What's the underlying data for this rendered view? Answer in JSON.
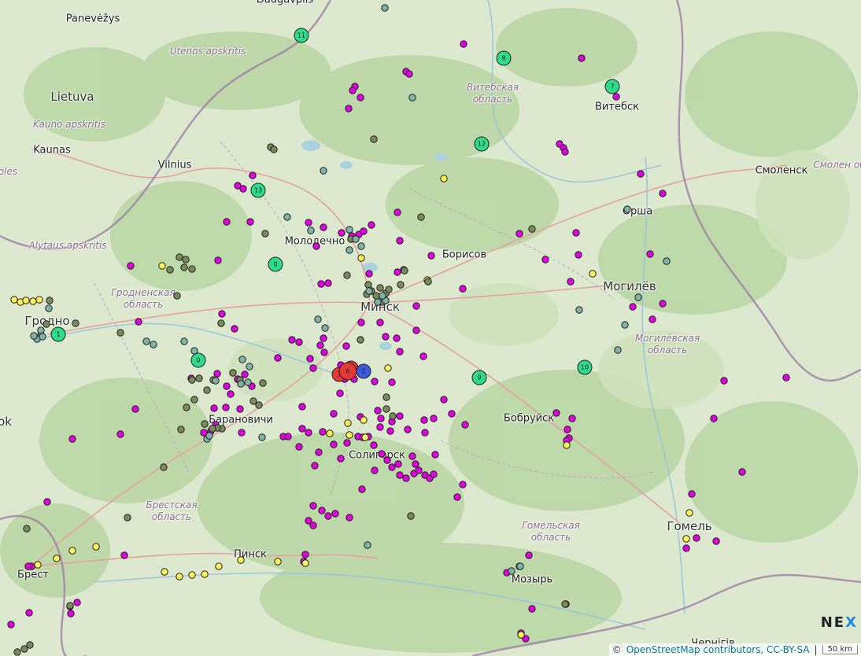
{
  "map": {
    "region_labels": [
      {
        "id": "utenos",
        "text": "Utenos apskritis"
      },
      {
        "id": "kauno",
        "text": "Kauno apskritis"
      },
      {
        "id": "alytaus",
        "text": "Alytaus apskritis"
      },
      {
        "id": "vitebsk-obl",
        "text": "Витебская область"
      },
      {
        "id": "grodno-obl",
        "text": "Гродненская область"
      },
      {
        "id": "mogilev-obl",
        "text": "Могилёвская область"
      },
      {
        "id": "brest-obl",
        "text": "Брестская область"
      },
      {
        "id": "gomel-obl",
        "text": "Гомельская область"
      },
      {
        "id": "smolensk-obl",
        "text": "Смолен обла"
      },
      {
        "id": "poles-obl",
        "text": "olės"
      }
    ],
    "city_labels": [
      {
        "id": "panevezys",
        "text": "Panevėžys"
      },
      {
        "id": "daugavpils",
        "text": "Daugavpils"
      },
      {
        "id": "lietuva",
        "text": "Lietuva"
      },
      {
        "id": "kaunas",
        "text": "Kaunas"
      },
      {
        "id": "vilnius",
        "text": "Vilnius"
      },
      {
        "id": "vitebsk",
        "text": "Витебск"
      },
      {
        "id": "smolensk",
        "text": "Смоленск"
      },
      {
        "id": "orsha",
        "text": "Орша"
      },
      {
        "id": "molodechno",
        "text": "Молодечно"
      },
      {
        "id": "borisov",
        "text": "Борисов"
      },
      {
        "id": "minsk",
        "text": "Минск"
      },
      {
        "id": "mogilev",
        "text": "Могилёв"
      },
      {
        "id": "grodno",
        "text": "Гродно"
      },
      {
        "id": "baranovichi",
        "text": "Барановичи"
      },
      {
        "id": "bobruisk",
        "text": "Бобруйск"
      },
      {
        "id": "soligorsk",
        "text": "Солигорск"
      },
      {
        "id": "pinsk",
        "text": "Пинск"
      },
      {
        "id": "brest",
        "text": "Брест"
      },
      {
        "id": "mozyr",
        "text": "Мозырь"
      },
      {
        "id": "gomel",
        "text": "Гомель"
      },
      {
        "id": "chernigov",
        "text": "Чернігів"
      },
      {
        "id": "bialystok",
        "text": "ok"
      }
    ],
    "marker_colors": {
      "magenta": "#e000e0",
      "yellow": "#fff35c",
      "olive": "#7a8a5a",
      "teal": "#7fb3a8",
      "cluster_green": "#2edb8a",
      "red": "#e53935",
      "blue": "#3b5bdb"
    },
    "clusters": [
      {
        "label": "11",
        "color": "cluster_green"
      },
      {
        "label": "8",
        "color": "cluster_green"
      },
      {
        "label": "7",
        "color": "cluster_green"
      },
      {
        "label": "12",
        "color": "cluster_green"
      },
      {
        "label": "13",
        "color": "cluster_green"
      },
      {
        "label": "0",
        "color": "cluster_green"
      },
      {
        "label": "1",
        "color": "cluster_green"
      },
      {
        "label": "0",
        "color": "cluster_green"
      },
      {
        "label": "9",
        "color": "cluster_green"
      },
      {
        "label": "10",
        "color": "cluster_green"
      },
      {
        "label": "3",
        "color": "red"
      },
      {
        "label": "6",
        "color": "red"
      },
      {
        "label": "2",
        "color": "blue"
      }
    ]
  },
  "attribution": {
    "prefix": "©",
    "link_text": "OpenStreetMap contributors, CC-BY-SA",
    "separator": "|"
  },
  "scale": {
    "text": "50 km"
  },
  "logo": {
    "text": "NE",
    "accent": "X"
  }
}
